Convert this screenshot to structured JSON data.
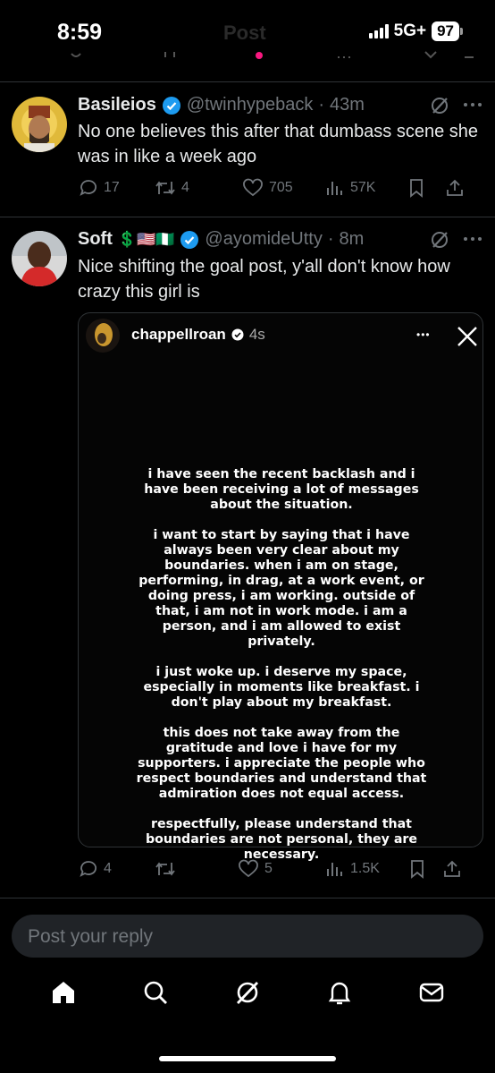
{
  "status_bar": {
    "time": "8:59",
    "network": "5G+",
    "battery": "97"
  },
  "header": {
    "title": "Post"
  },
  "tweets": [
    {
      "name": "Basileios",
      "handle": "@twinhypeback",
      "sep": "·",
      "time": "43m",
      "text": "No one believes this after that dumbass scene she was in like a week ago",
      "replies": "17",
      "reposts": "4",
      "likes": "705",
      "views": "57K"
    },
    {
      "name": "Soft",
      "name_emoji": "💲🇺🇸🇳🇬",
      "handle": "@ayomideUtty",
      "sep": "·",
      "time": "8m",
      "text": "Nice shifting the goal post, y'all don't know how crazy this girl is",
      "replies": "4",
      "reposts": "",
      "likes": "5",
      "views": "1.5K"
    }
  ],
  "story": {
    "username": "chappellroan",
    "time": "4s",
    "more": "•••",
    "paragraphs": [
      "i have seen the recent backlash and i have been receiving a lot of messages about the situation.",
      "i want to start by saying that i have always been very clear about my boundaries. when i am on stage, performing, in drag, at a work event, or doing press, i am working. outside of that, i am not in work mode. i am a person, and i am allowed to exist privately.",
      "i just woke up. i deserve my space, especially in moments like breakfast. i don't play about my breakfast.",
      "this does not take away from the gratitude and love i have for my supporters. i appreciate the people who respect boundaries and understand that admiration does not equal access.",
      "respectfully, please understand that boundaries are not personal, they are necessary."
    ]
  },
  "reply": {
    "placeholder": "Post your reply"
  },
  "colors": {
    "verified": "#1d9bf0",
    "muted": "#71767b",
    "divider": "#2f3336",
    "background": "#000000"
  },
  "nav_icons": [
    "home-icon",
    "search-icon",
    "grok-icon",
    "notifications-icon",
    "messages-icon"
  ]
}
